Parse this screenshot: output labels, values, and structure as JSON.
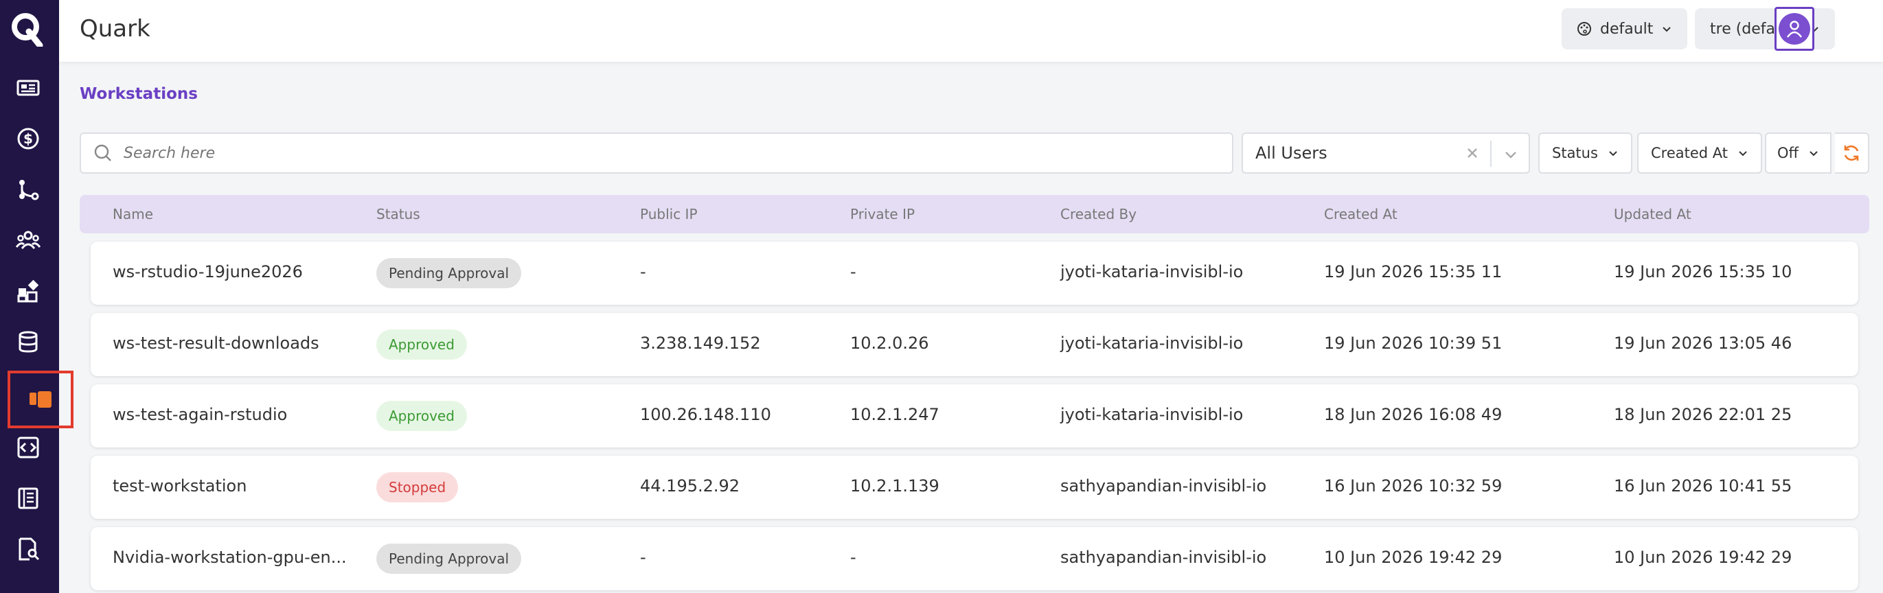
{
  "app": {
    "title": "Quark"
  },
  "header": {
    "theme_label": "default",
    "tenant_label": "tre (default)"
  },
  "page": {
    "title": "Workstations"
  },
  "toolbar": {
    "search_placeholder": "Search here",
    "users_select_value": "All Users",
    "status_filter_label": "Status",
    "created_at_filter_label": "Created At",
    "auto_refresh_label": "Off"
  },
  "table": {
    "columns": [
      "Name",
      "Status",
      "Public IP",
      "Private IP",
      "Created By",
      "Created At",
      "Updated At"
    ],
    "rows": [
      {
        "name": "ws-rstudio-19june2026",
        "status": "Pending Approval",
        "status_kind": "pending",
        "public_ip": "-",
        "private_ip": "-",
        "created_by": "jyoti-kataria-invisibl-io",
        "created_at": "19 Jun 2026 15:35 11",
        "updated_at": "19 Jun 2026 15:35 10"
      },
      {
        "name": "ws-test-result-downloads",
        "status": "Approved",
        "status_kind": "approved",
        "public_ip": "3.238.149.152",
        "private_ip": "10.2.0.26",
        "created_by": "jyoti-kataria-invisibl-io",
        "created_at": "19 Jun 2026 10:39 51",
        "updated_at": "19 Jun 2026 13:05 46"
      },
      {
        "name": "ws-test-again-rstudio",
        "status": "Approved",
        "status_kind": "approved",
        "public_ip": "100.26.148.110",
        "private_ip": "10.2.1.247",
        "created_by": "jyoti-kataria-invisibl-io",
        "created_at": "18 Jun 2026 16:08 49",
        "updated_at": "18 Jun 2026 22:01 25"
      },
      {
        "name": "test-workstation",
        "status": "Stopped",
        "status_kind": "stopped",
        "public_ip": "44.195.2.92",
        "private_ip": "10.2.1.139",
        "created_by": "sathyapandian-invisibl-io",
        "created_at": "16 Jun 2026 10:32 59",
        "updated_at": "16 Jun 2026 10:41 55"
      },
      {
        "name": "Nvidia-workstation-gpu-en...",
        "status": "Pending Approval",
        "status_kind": "pending",
        "public_ip": "-",
        "private_ip": "-",
        "created_by": "sathyapandian-invisibl-io",
        "created_at": "10 Jun 2026 19:42 29",
        "updated_at": "10 Jun 2026 19:42 29"
      }
    ]
  },
  "sidebar": {
    "items": [
      {
        "icon": "dashboard-icon"
      },
      {
        "icon": "billing-icon"
      },
      {
        "icon": "pipeline-icon"
      },
      {
        "icon": "users-icon"
      },
      {
        "icon": "apps-icon"
      },
      {
        "icon": "database-icon"
      },
      {
        "icon": "workstations-icon",
        "active": true
      },
      {
        "icon": "code-icon"
      },
      {
        "icon": "notebook-icon"
      },
      {
        "icon": "search-document-icon"
      }
    ]
  },
  "colors": {
    "sidebar_bg": "#201545",
    "accent": "#6a3fc3",
    "active_highlight": "#e23b2e",
    "table_header_bg": "#e5ddf4",
    "refresh_icon": "#f07a2a"
  }
}
